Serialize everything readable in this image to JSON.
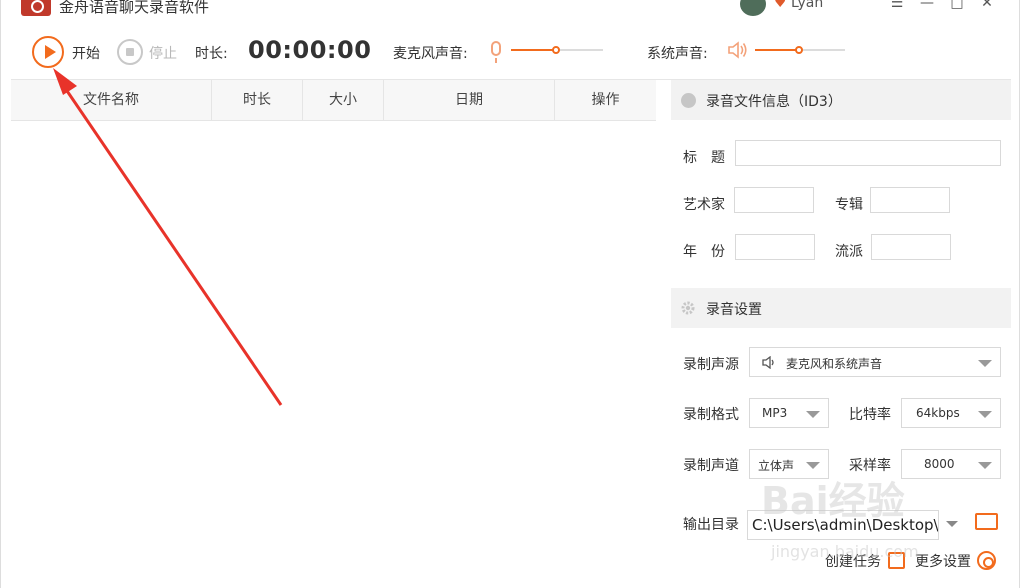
{
  "app": {
    "title": "金舟语音聊天录音软件",
    "user_name": "Lyan"
  },
  "window_controls": {
    "menu": "☰",
    "minimize": "—",
    "maximize": "□",
    "close": "✕"
  },
  "toolbar": {
    "start_label": "开始",
    "stop_label": "停止",
    "duration_label": "时长:",
    "timer": "00:00:00",
    "mic_label": "麦克风声音:",
    "system_label": "系统声音:",
    "mic_volume": 0.5,
    "system_volume": 0.5
  },
  "file_table": {
    "columns": [
      "文件名称",
      "时长",
      "大小",
      "日期",
      "操作"
    ],
    "rows": []
  },
  "id3_section": {
    "title": "录音文件信息（ID3）",
    "title_label": "标　题",
    "artist_label": "艺术家",
    "album_label": "专辑",
    "year_label": "年　份",
    "genre_label": "流派",
    "title_value": "",
    "artist_value": "",
    "album_value": "",
    "year_value": "",
    "genre_value": ""
  },
  "settings_section": {
    "title": "录音设置",
    "source_label": "录制声源",
    "source_value": "麦克风和系统声音",
    "format_label": "录制格式",
    "format_value": "MP3",
    "bitrate_label": "比特率",
    "bitrate_value": "64kbps",
    "channel_label": "录制声道",
    "channel_value": "立体声",
    "samplerate_label": "采样率",
    "samplerate_value": "8000",
    "output_label": "输出目录",
    "output_value": "C:\\Users\\admin\\Desktop\\",
    "create_task": "创建任务",
    "more_settings": "更多设置"
  },
  "watermark": {
    "main": "Bai经验",
    "sub": "jingyan.baidu.com"
  },
  "colors": {
    "accent": "#f26b1d",
    "arrow": "#e8332a"
  }
}
